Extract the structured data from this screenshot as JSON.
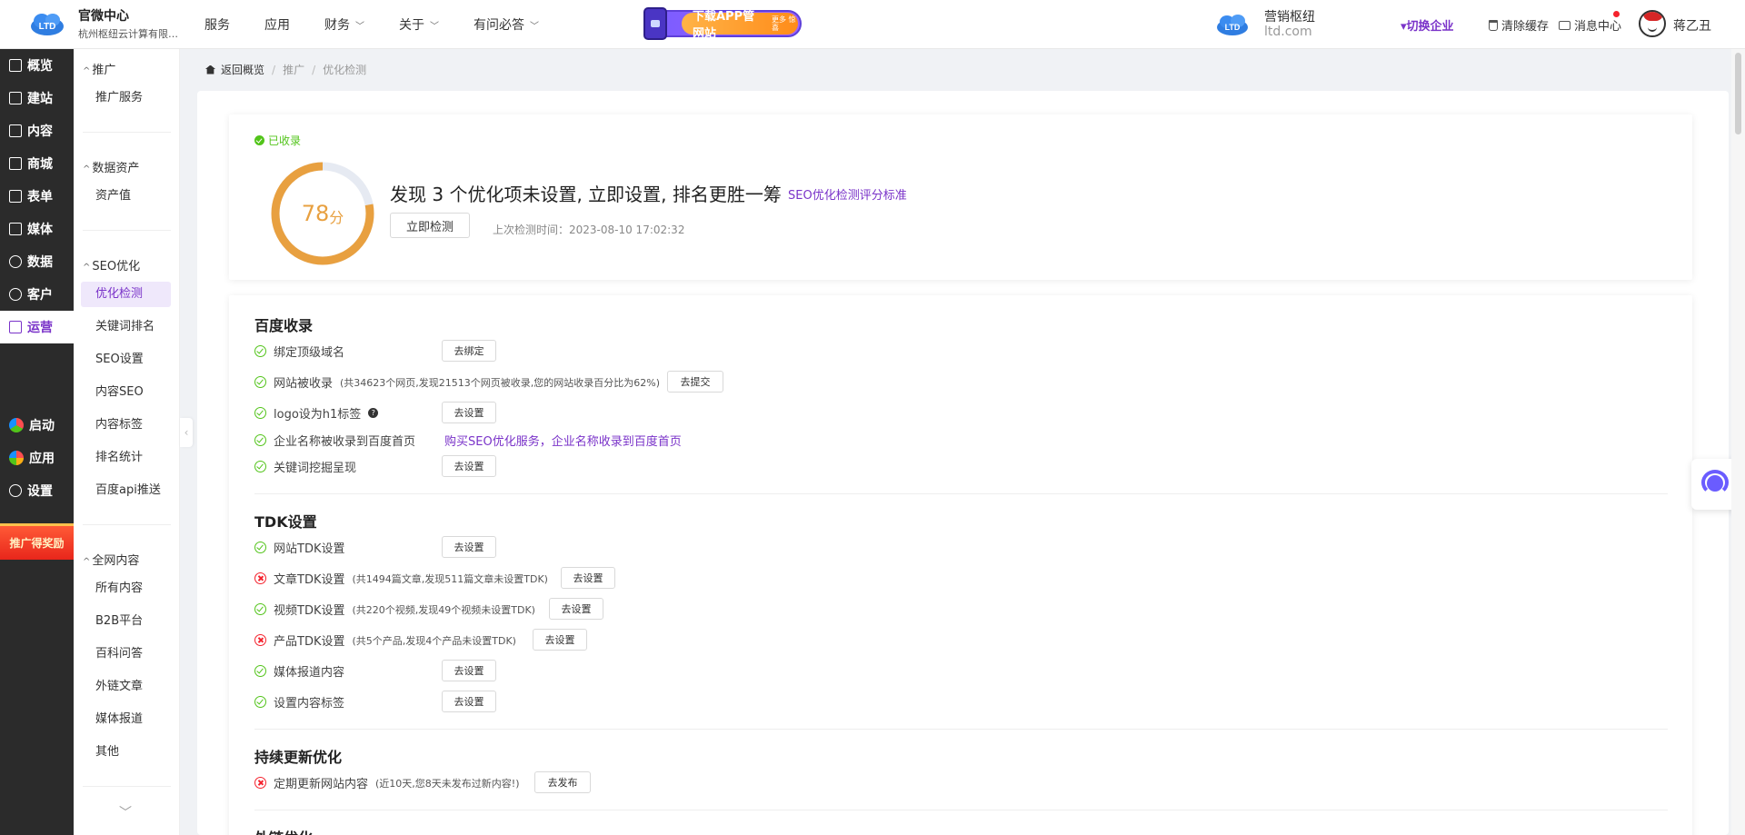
{
  "header": {
    "brand_title": "官微中心",
    "brand_subtitle": "杭州枢纽云计算有限公...",
    "nav": [
      {
        "label": "服务",
        "dropdown": false
      },
      {
        "label": "应用",
        "dropdown": false
      },
      {
        "label": "财务",
        "dropdown": true
      },
      {
        "label": "关于",
        "dropdown": true
      },
      {
        "label": "有问必答",
        "dropdown": true
      }
    ],
    "banner_text": "下载APP管网站",
    "banner_small": "更多 惊喜",
    "logo_text": "LTD",
    "company_name": "营销枢纽",
    "company_domain": "ltd.com",
    "switch_label": "▾切换企业",
    "clear_cache": "清除缓存",
    "message_center": "消息中心",
    "user_name": "蒋乙丑"
  },
  "sidebar": {
    "items": [
      {
        "label": "概览"
      },
      {
        "label": "建站"
      },
      {
        "label": "内容"
      },
      {
        "label": "商城"
      },
      {
        "label": "表单"
      },
      {
        "label": "媒体"
      },
      {
        "label": "数据"
      },
      {
        "label": "客户"
      },
      {
        "label": "运营",
        "active": true
      },
      {
        "label": "启动"
      },
      {
        "label": "应用"
      },
      {
        "label": "设置"
      }
    ],
    "promo": "推广得奖励"
  },
  "subsidebar": {
    "groups": [
      {
        "title": "推广",
        "links": [
          "推广服务"
        ]
      },
      {
        "title": "数据资产",
        "links": [
          "资产值"
        ]
      },
      {
        "title": "SEO优化",
        "links": [
          "优化检测",
          "关键词排名",
          "SEO设置",
          "内容SEO",
          "内容标签",
          "排名统计",
          "百度api推送"
        ]
      },
      {
        "title": "全网内容",
        "links": [
          "所有内容",
          "B2B平台",
          "百科问答",
          "外链文章",
          "媒体报道",
          "其他"
        ]
      }
    ],
    "active_link": "优化检测"
  },
  "breadcrumb": {
    "home": "返回概览",
    "items": [
      "推广",
      "优化检测"
    ]
  },
  "summary": {
    "status": "已收录",
    "score": 78,
    "score_unit": "分",
    "score_max": 100,
    "headline": "发现 3 个优化项未设置, 立即设置, 排名更胜一筹",
    "standard_link": "SEO优化检测评分标准",
    "check_button": "立即检测",
    "last_check": "上次检测时间：2023-08-10 17:02:32",
    "colors": {
      "ring": "#e8a040",
      "ring_track": "#e6eaf2",
      "accent": "#7a33c9"
    }
  },
  "sections": [
    {
      "title": "百度收录",
      "rows": [
        {
          "label": "绑定顶级域名",
          "ok": true,
          "note": "",
          "button": "去绑定"
        },
        {
          "label": "网站被收录",
          "ok": true,
          "note": "(共34623个网页,发现21513个网页被收录,您的网站收录百分比为62%)",
          "button": "去提交"
        },
        {
          "label": "logo设为h1标签",
          "ok": true,
          "note": "",
          "help": "?",
          "button": "去设置"
        },
        {
          "label": "企业名称被收录到百度首页",
          "ok": true,
          "note": "",
          "link": "购买SEO优化服务，企业名称收录到百度首页"
        },
        {
          "label": "关键词挖掘呈现",
          "ok": true,
          "note": "",
          "button": "去设置"
        }
      ]
    },
    {
      "title": "TDK设置",
      "rows": [
        {
          "label": "网站TDK设置",
          "ok": true,
          "note": "",
          "button": "去设置"
        },
        {
          "label": "文章TDK设置",
          "ok": false,
          "note": "(共1494篇文章,发现511篇文章未设置TDK)",
          "button": "去设置"
        },
        {
          "label": "视频TDK设置",
          "ok": true,
          "note": "(共220个视频,发现49个视频未设置TDK)",
          "button": "去设置"
        },
        {
          "label": "产品TDK设置",
          "ok": false,
          "note": "(共5个产品,发现4个产品未设置TDK)",
          "button": "去设置"
        },
        {
          "label": "媒体报道内容",
          "ok": true,
          "note": "",
          "button": "去设置"
        },
        {
          "label": "设置内容标签",
          "ok": true,
          "note": "",
          "button": "去设置"
        }
      ]
    },
    {
      "title": "持续更新优化",
      "rows": [
        {
          "label": "定期更新网站内容",
          "ok": false,
          "note": "(近10天,您8天未发布过新内容!)",
          "button": "去发布"
        }
      ]
    },
    {
      "title": "外链优化",
      "rows": []
    }
  ]
}
